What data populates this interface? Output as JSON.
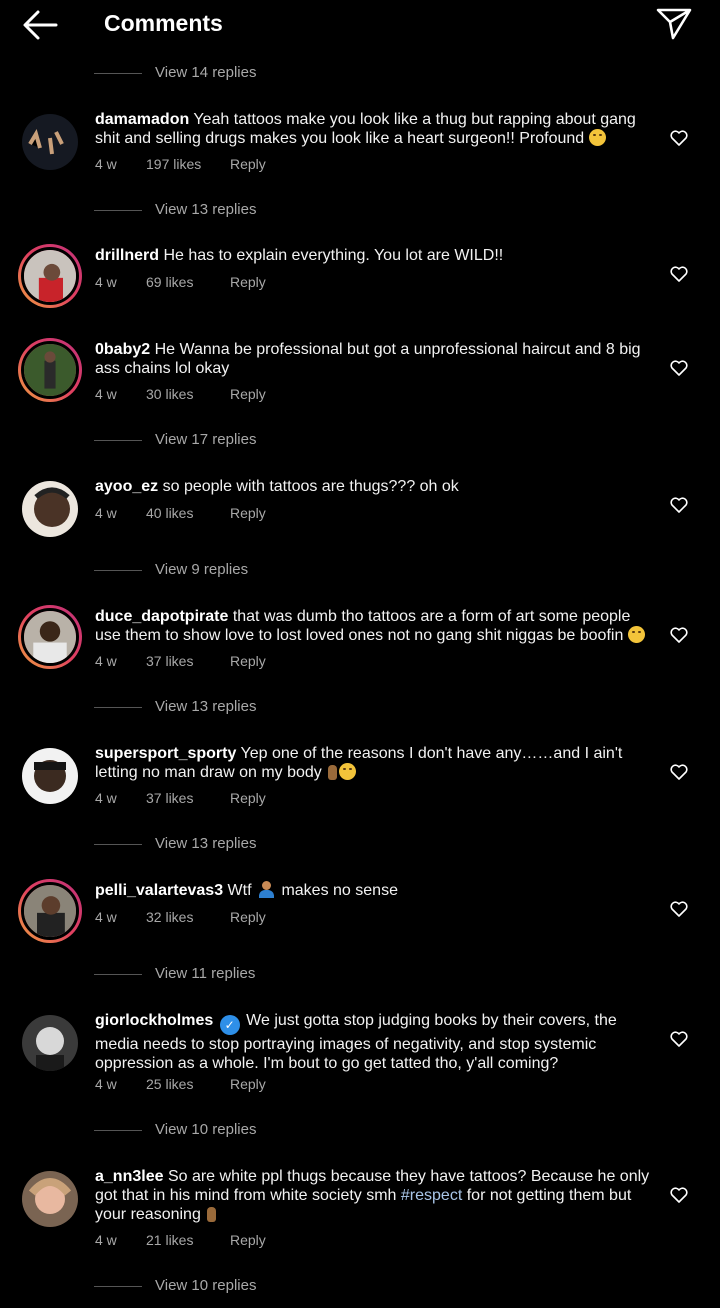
{
  "header": {
    "title": "Comments",
    "back_icon": "back-arrow-icon",
    "send_icon": "send-icon"
  },
  "comments": [
    {
      "replies_above": "View 14 replies"
    },
    {
      "username": "damamadon",
      "text": "Yeah tattoos make you look like a thug but rapping about gang shit and selling drugs makes you look like a heart surgeon!! Profound",
      "emoji": "grinning-sweat-emoji",
      "time": "4 w",
      "likes": "197 likes",
      "reply": "Reply",
      "replies": "View 13 replies"
    },
    {
      "username": "drillnerd",
      "text": "He has to explain everything. You lot are WILD!!",
      "time": "4 w",
      "likes": "69 likes",
      "reply": "Reply"
    },
    {
      "username": "0baby2",
      "text": "He Wanna be professional but got a unprofessional haircut and 8 big ass chains lol okay",
      "time": "4 w",
      "likes": "30 likes",
      "reply": "Reply",
      "replies": "View 17 replies"
    },
    {
      "username": "ayoo_ez",
      "text": "so people with tattoos are thugs??? oh ok",
      "time": "4 w",
      "likes": "40 likes",
      "reply": "Reply",
      "replies": "View 9 replies"
    },
    {
      "username": "duce_dapotpirate",
      "text": "that was dumb tho tattoos are a form of art some people use them to show love to lost loved ones not no gang shit niggas be boofin",
      "emoji": "rofl-emoji",
      "time": "4 w",
      "likes": "37 likes",
      "reply": "Reply",
      "replies": "View 13 replies"
    },
    {
      "username": "supersport_sporty",
      "text": "Yep one of the reasons I don't have any……and I ain't letting no man draw on my body",
      "emoji": "thumbs-down-rofl-emoji",
      "time": "4 w",
      "likes": "37 likes",
      "reply": "Reply",
      "replies": "View 13 replies"
    },
    {
      "username": "pelli_valartevas3",
      "text_before": "Wtf",
      "text_after": "makes no sense",
      "emoji": "facepalm-emoji",
      "time": "4 w",
      "likes": "32 likes",
      "reply": "Reply",
      "replies": "View 11 replies"
    },
    {
      "username": "giorlockholmes",
      "verified": true,
      "text": "We just gotta stop judging books by their covers, the media needs to stop portraying images of negativity, and stop systemic oppression as a whole. I'm bout to go get tatted tho, y'all coming?",
      "time": "4 w",
      "likes": "25 likes",
      "reply": "Reply",
      "replies": "View 10 replies"
    },
    {
      "username": "a_nn3lee",
      "text_before": "So are white ppl thugs because they have tattoos? Because he only got that in his mind from white society smh",
      "hashtag": "#respect",
      "text_after": "for not getting them but your reasoning",
      "emoji": "thumbs-down-emoji",
      "time": "4 w",
      "likes": "21 likes",
      "reply": "Reply",
      "replies": "View 10 replies"
    }
  ],
  "colors": {
    "background": "#000000",
    "text": "#ffffff",
    "muted": "#a8a8a8",
    "hashtag": "#a9c6e8",
    "verified": "#2e8fe8"
  }
}
